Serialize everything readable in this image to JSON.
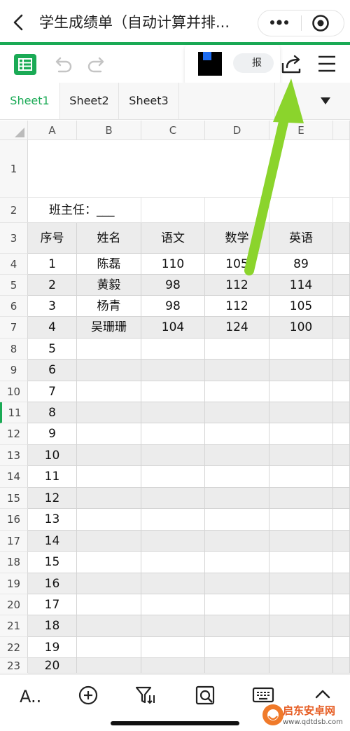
{
  "topbar": {
    "title": "学生成绩单（自动计算并排..."
  },
  "toolbar": {
    "pill_text": "报"
  },
  "tabs": [
    {
      "label": "Sheet1"
    },
    {
      "label": "Sheet2"
    },
    {
      "label": "Sheet3"
    }
  ],
  "grid": {
    "columns": [
      "A",
      "B",
      "C",
      "D",
      "E"
    ],
    "rows": [
      "1",
      "2",
      "3",
      "4",
      "5",
      "6",
      "7",
      "8",
      "9",
      "10",
      "11",
      "12",
      "13",
      "14",
      "15",
      "16",
      "17",
      "18",
      "19",
      "20",
      "21",
      "22",
      "23"
    ],
    "head_teacher": "班主任：___",
    "headers": [
      "序号",
      "姓名",
      "语文",
      "数学",
      "英语"
    ],
    "data": [
      [
        "1",
        "陈磊",
        "110",
        "105",
        "89"
      ],
      [
        "2",
        "黄毅",
        "98",
        "112",
        "114"
      ],
      [
        "3",
        "杨青",
        "98",
        "112",
        "105"
      ],
      [
        "4",
        "吴珊珊",
        "104",
        "124",
        "100"
      ]
    ],
    "serials": [
      "5",
      "6",
      "7",
      "8",
      "9",
      "10",
      "11",
      "12",
      "13",
      "14",
      "15",
      "16",
      "17",
      "18",
      "19",
      "20"
    ]
  },
  "bottombar": {
    "font_label": "A.."
  },
  "watermark": {
    "text": "启东安卓网",
    "url": "www.qdtdsb.com"
  },
  "colors": {
    "accent": "#1aaa55",
    "arrow": "#8bd42c",
    "watermark": "#e65c22"
  },
  "icons": [
    "back-icon",
    "more-icon",
    "target-icon",
    "sheet-logo-icon",
    "undo-icon",
    "redo-icon",
    "share-icon",
    "menu-icon",
    "dropdown-icon",
    "add-icon",
    "filter-icon",
    "search-icon",
    "keyboard-icon",
    "collapse-icon"
  ]
}
